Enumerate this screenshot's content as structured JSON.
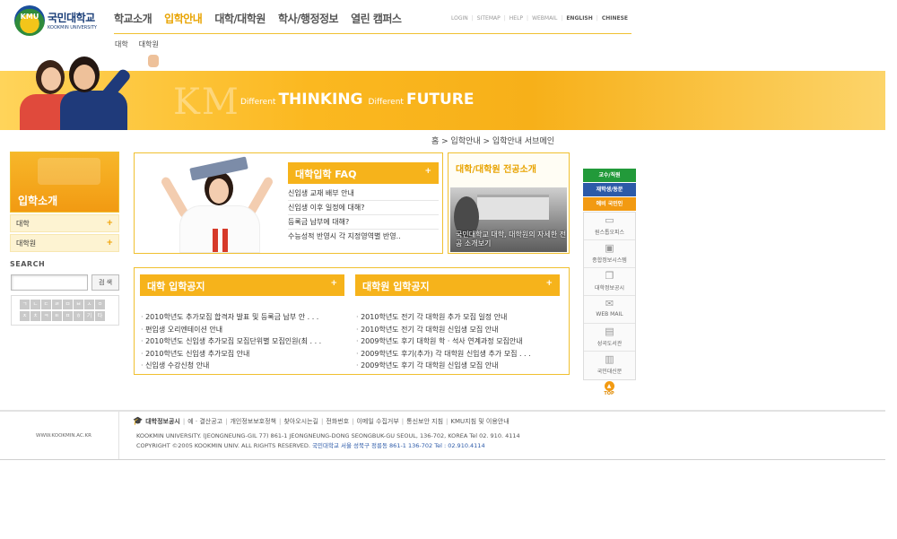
{
  "logo": {
    "mark": "KMU",
    "name": "국민대학교",
    "sub": "KOOKMIN UNIVERSITY"
  },
  "gnb": [
    {
      "label": "학교소개",
      "active": false
    },
    {
      "label": "입학안내",
      "active": true
    },
    {
      "label": "대학/대학원",
      "active": false
    },
    {
      "label": "학사/행정정보",
      "active": false
    },
    {
      "label": "열린 캠퍼스",
      "active": false
    }
  ],
  "util": [
    "LOGIN",
    "SITEMAP",
    "HELP",
    "WEBMAIL",
    "ENGLISH",
    "CHINESE"
  ],
  "subnav": [
    "대학",
    "대학원"
  ],
  "banner": {
    "watermark": "KM",
    "small1": "Different",
    "big1": "THINKING",
    "small2": "Different",
    "big2": "FUTURE"
  },
  "breadcrumb": "홈 > 입학안내 > 입학안내 서브메인",
  "sidebar": {
    "title": "입학소개",
    "items": [
      {
        "label": "대학",
        "icon": "plus-icon",
        "plus": "+"
      },
      {
        "label": "대학원",
        "icon": "plus-icon",
        "plus": "+"
      }
    ]
  },
  "search": {
    "label": "SEARCH",
    "value": "",
    "button": "검 색",
    "initials": [
      "ㄱ",
      "ㄴ",
      "ㄷ",
      "ㄹ",
      "ㅁ",
      "ㅂ",
      "ㅅ",
      "ㅇ",
      "ㅈ",
      "ㅊ",
      "ㅋ",
      "ㅌ",
      "ㅍ",
      "ㅎ",
      "기",
      "타"
    ]
  },
  "faq": {
    "title": "대학입학 FAQ",
    "plus": "+",
    "items": [
      "신입생 교재 배부 안내",
      "신입생 이후 일정에 대해?",
      "등록금 납부에 대해?",
      "수능성적 반영시 각 지정영역별 반영.."
    ]
  },
  "major": {
    "title": "대학/대학원 전공소개",
    "caption": "국민대학교 대학, 대학원의 자세한 전공 소개보기"
  },
  "notices": {
    "college": {
      "title": "대학 입학공지",
      "plus": "+",
      "items": [
        "2010학년도 추가모집 합격자 발표 및 등록금 납부 안 . . .",
        "편입생 오리엔테이션 안내",
        "2010학년도 신입생 추가모집 모집단위별 모집인원(최 . . .",
        "2010학년도 신입생 추가모집 안내",
        "신입생 수강신청 안내"
      ]
    },
    "graduate": {
      "title": "대학원 입학공지",
      "plus": "+",
      "items": [
        "2010학년도 전기 각 대학원 추가 모집 일정 안내",
        "2010학년도 전기 각 대학원 신입생 모집 안내",
        "2009학년도 후기 대학원 학 · 석사 연계과정 모집안내",
        "2009학년도 후기(추가) 각 대학원 신입생 추가 모집 . . .",
        "2009학년도 후기 각 대학원 신입생 모집 안내"
      ]
    }
  },
  "quick": {
    "buttons": [
      {
        "label": "교수/직원",
        "color": "#229a3a"
      },
      {
        "label": "재학생/동문",
        "color": "#2c5aa8"
      },
      {
        "label": "예비 국민인",
        "color": "#f29a12"
      }
    ],
    "items": [
      {
        "label": "원스톱오피스",
        "icon": "monitor-icon",
        "glyph": "▭"
      },
      {
        "label": "종합정보시스템",
        "icon": "computer-icon",
        "glyph": "▣"
      },
      {
        "label": "대학정보공시",
        "icon": "book-icon",
        "glyph": "❐"
      },
      {
        "label": "WEB MAIL",
        "icon": "mail-icon",
        "glyph": "✉"
      },
      {
        "label": "성곡도서관",
        "icon": "library-icon",
        "glyph": "▤"
      },
      {
        "label": "국민대신문",
        "icon": "newspaper-icon",
        "glyph": "▥"
      }
    ],
    "top": "TOP"
  },
  "footer": {
    "url": "WWW.KOOKMIN.AC.KR",
    "links": [
      "대학정보공시",
      "예 · 결산공고",
      "개인정보보호정책",
      "찾아오시는길",
      "전화번호",
      "이메일 수집거부",
      "통신보안 지침",
      "KMU지침 및 이용안내"
    ],
    "address": "KOOKMIN UNIVERSITY. (JEONGNEUNG-GIL 77) 861-1 JEONGNEUNG-DONG SEONGBUK-GU SEOUL, 136-702, KOREA Tel 02. 910. 4114",
    "copyright": "COPYRIGHT ©2005 KOOKMIN UNIV. ALL RIGHTS RESERVED.",
    "copyright_kr": "국민대학교 서울 성북구 정릉동 861-1 136-702 Tel : 02.910.4114"
  },
  "colors": {
    "accent": "#f6b31b",
    "active_menu": "#e8a300",
    "link_blue": "#2c5aa8"
  }
}
